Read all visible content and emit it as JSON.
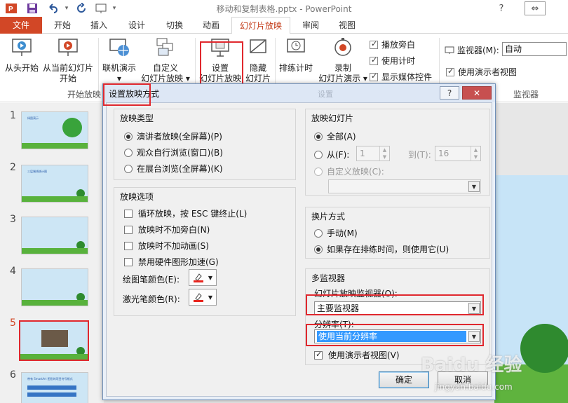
{
  "window": {
    "title": "移动和复制表格.pptx - PowerPoint",
    "help_btn": "?",
    "minimize_btn": "—",
    "restore_btn": "▭",
    "close_btn": "✕"
  },
  "tabs": [
    {
      "label": "文件"
    },
    {
      "label": "开始"
    },
    {
      "label": "插入"
    },
    {
      "label": "设计"
    },
    {
      "label": "切换"
    },
    {
      "label": "动画"
    },
    {
      "label": "幻灯片放映"
    },
    {
      "label": "审阅"
    },
    {
      "label": "视图"
    }
  ],
  "ribbon": {
    "from_start": "从头开始",
    "from_current_l1": "从当前幻灯片",
    "from_current_l2": "开始",
    "online_present_l1": "联机演示",
    "online_present_l2": "▾",
    "custom_l1": "自定义",
    "custom_l2": "幻灯片放映 ▾",
    "group_start": "开始放映",
    "setup_l1": "设置",
    "setup_l2": "幻灯片放映",
    "hide_l1": "隐藏",
    "hide_l2": "幻灯片",
    "rehearse": "排练计时",
    "record_l1": "录制",
    "record_l2": "幻灯片演示 ▾",
    "play_narration": "播放旁白",
    "use_timings": "使用计时",
    "show_media": "显示媒体控件",
    "monitor_label": "监视器(M):",
    "monitor_value": "自动",
    "presenter_view": "使用演示者视图",
    "group_monitors": "监视器"
  },
  "slides": [
    {
      "num": "1",
      "caption": "绿图演示"
    },
    {
      "num": "2",
      "caption": "三层端线统计图"
    },
    {
      "num": "3",
      "caption": ""
    },
    {
      "num": "4",
      "caption": ""
    },
    {
      "num": "5",
      "caption": ""
    },
    {
      "num": "6",
      "caption": "带有 SmartArt 图形的项目符号格式"
    }
  ],
  "dialog": {
    "title": "设置放映方式",
    "title_faint": "设置",
    "help_btn": "?",
    "close_btn": "✕",
    "show_type": {
      "title": "放映类型",
      "options": [
        "演讲者放映(全屏幕)(P)",
        "观众自行浏览(窗口)(B)",
        "在展台浏览(全屏幕)(K)"
      ],
      "selected": 0
    },
    "show_options": {
      "title": "放映选项",
      "checks": [
        "循环放映，按 ESC 键终止(L)",
        "放映时不加旁白(N)",
        "放映时不加动画(S)",
        "禁用硬件图形加速(G)"
      ],
      "pen_color": "绘图笔颜色(E):",
      "laser_color": "激光笔颜色(R):"
    },
    "show_slides": {
      "title": "放映幻灯片",
      "all": "全部(A)",
      "from": "从(F):",
      "from_value": "1",
      "to": "到(T):",
      "to_value": "16",
      "custom": "自定义放映(C):",
      "custom_value": ""
    },
    "advance": {
      "title": "换片方式",
      "manual": "手动(M)",
      "timings": "如果存在排练时间，则使用它(U)"
    },
    "multi": {
      "title": "多监视器",
      "monitor_label": "幻灯片放映监视器(O):",
      "monitor_value": "主要监视器",
      "resolution_label": "分辨率(T):",
      "resolution_value": "使用当前分辨率",
      "presenter_view": "使用演示者视图(V)"
    },
    "ok": "确定",
    "cancel": "取消"
  },
  "watermark": {
    "logo": "Baidu 经验",
    "url": "jingyan.baidu.com"
  },
  "colors": {
    "accent": "#d24726",
    "highlight": "#e0282e",
    "selection": "#3399ff"
  }
}
